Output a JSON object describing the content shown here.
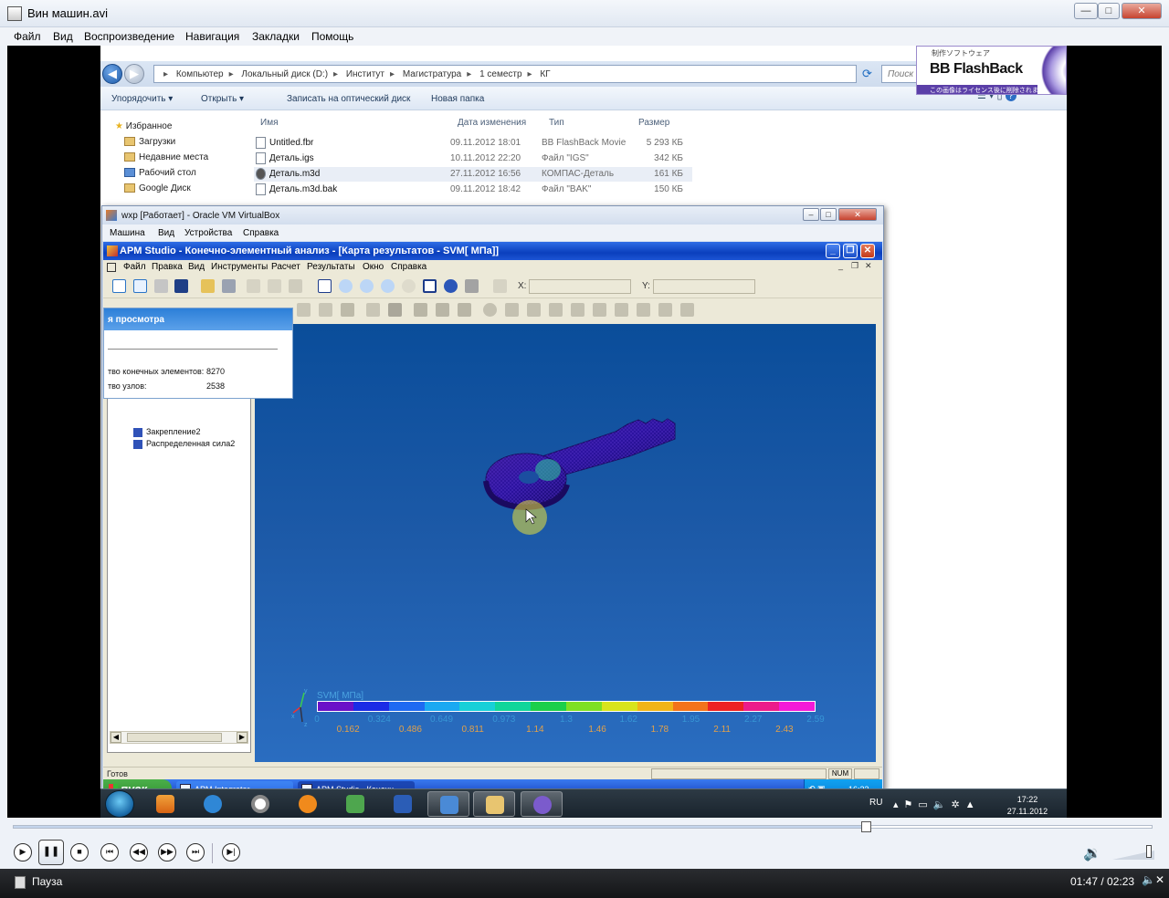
{
  "window": {
    "title": "Вин машин.avi",
    "minimize": "—",
    "maximize": "□",
    "close": "✕"
  },
  "menubar": [
    "Файл",
    "Вид",
    "Воспроизведение",
    "Навигация",
    "Закладки",
    "Помощь"
  ],
  "explorer": {
    "breadcrumb": [
      "Компьютер",
      "Локальный диск (D:)",
      "Институт",
      "Магистратура",
      "1 семестр",
      "КГ"
    ],
    "search_placeholder": "Поиск",
    "commands": [
      "Упорядочить ▾",
      "Открыть ▾",
      "Записать на оптический диск",
      "Новая папка"
    ],
    "nav": [
      "Избранное",
      "Загрузки",
      "Недавние места",
      "Рабочий стол",
      "Google Диск"
    ],
    "columns": [
      "Имя",
      "Дата изменения",
      "Тип",
      "Размер"
    ],
    "files": [
      {
        "name": "Untitled.fbr",
        "date": "09.11.2012 18:01",
        "type": "BB FlashBack Movie",
        "size": "5 293 КБ"
      },
      {
        "name": "Деталь.igs",
        "date": "10.11.2012 22:20",
        "type": "Файл \"IGS\"",
        "size": "342 КБ"
      },
      {
        "name": "Деталь.m3d",
        "date": "27.11.2012 16:56",
        "type": "КОМПАС-Деталь",
        "size": "161 КБ"
      },
      {
        "name": "Деталь.m3d.bak",
        "date": "09.11.2012 18:42",
        "type": "Файл \"BAK\"",
        "size": "150 КБ"
      }
    ]
  },
  "watermark": {
    "jp_top": "制作ソフトウェア",
    "brand": "BB FlashBack",
    "jp_bottom": "この画像はライセンス後に削除されます"
  },
  "vbox": {
    "title": "wxp [Работает] - Oracle VM VirtualBox",
    "menu": [
      "Машина",
      "Вид",
      "Устройства",
      "Справка"
    ]
  },
  "apm": {
    "title": "APM Studio - Конечно-элементный анализ - [Карта результатов - SVM[ МПа]]",
    "menu": [
      "Файл",
      "Правка",
      "Вид",
      "Инструменты",
      "Расчет",
      "Результаты",
      "Окно",
      "Справка"
    ],
    "x_label": "X:",
    "y_label": "Y:",
    "info_header": "я просмотра",
    "info_rows": [
      {
        "label": "тво конечных элементов:",
        "value": "8270"
      },
      {
        "label": "тво узлов:",
        "value": "2538"
      }
    ],
    "tree": [
      "Закрепление2",
      "Распределенная сила2"
    ],
    "legend_title": "SVM[ МПа]",
    "legend_upper": [
      "0",
      "0.324",
      "0.649",
      "0.973",
      "1.3",
      "1.62",
      "1.95",
      "2.27",
      "2.59"
    ],
    "legend_lower": [
      "0.162",
      "0.486",
      "0.811",
      "1.14",
      "1.46",
      "1.78",
      "2.11",
      "2.43"
    ],
    "legend_colors": [
      "#6a11c8",
      "#1b2be6",
      "#1f6af2",
      "#1aa9f2",
      "#17d0d8",
      "#10d69a",
      "#1ccf4a",
      "#7ee022",
      "#d8e41c",
      "#f2b417",
      "#f3731a",
      "#ee2222",
      "#ec1b8a",
      "#f31ad8"
    ],
    "status_text": "Готов",
    "status_num": "NUM",
    "axis": {
      "y": "y",
      "x": "x",
      "z": "z"
    }
  },
  "xp_taskbar": {
    "start": "пуск",
    "tasks": [
      "APM Integrator",
      "APM Studio - Конечн..."
    ],
    "clock": "16:23"
  },
  "w7_taskbar": {
    "lang": "RU",
    "time": "17:22",
    "date": "27.11.2012"
  },
  "player": {
    "status": "Пауза",
    "time": "01:47 / 02:23",
    "progress": 0.748,
    "volume": 0.9
  }
}
